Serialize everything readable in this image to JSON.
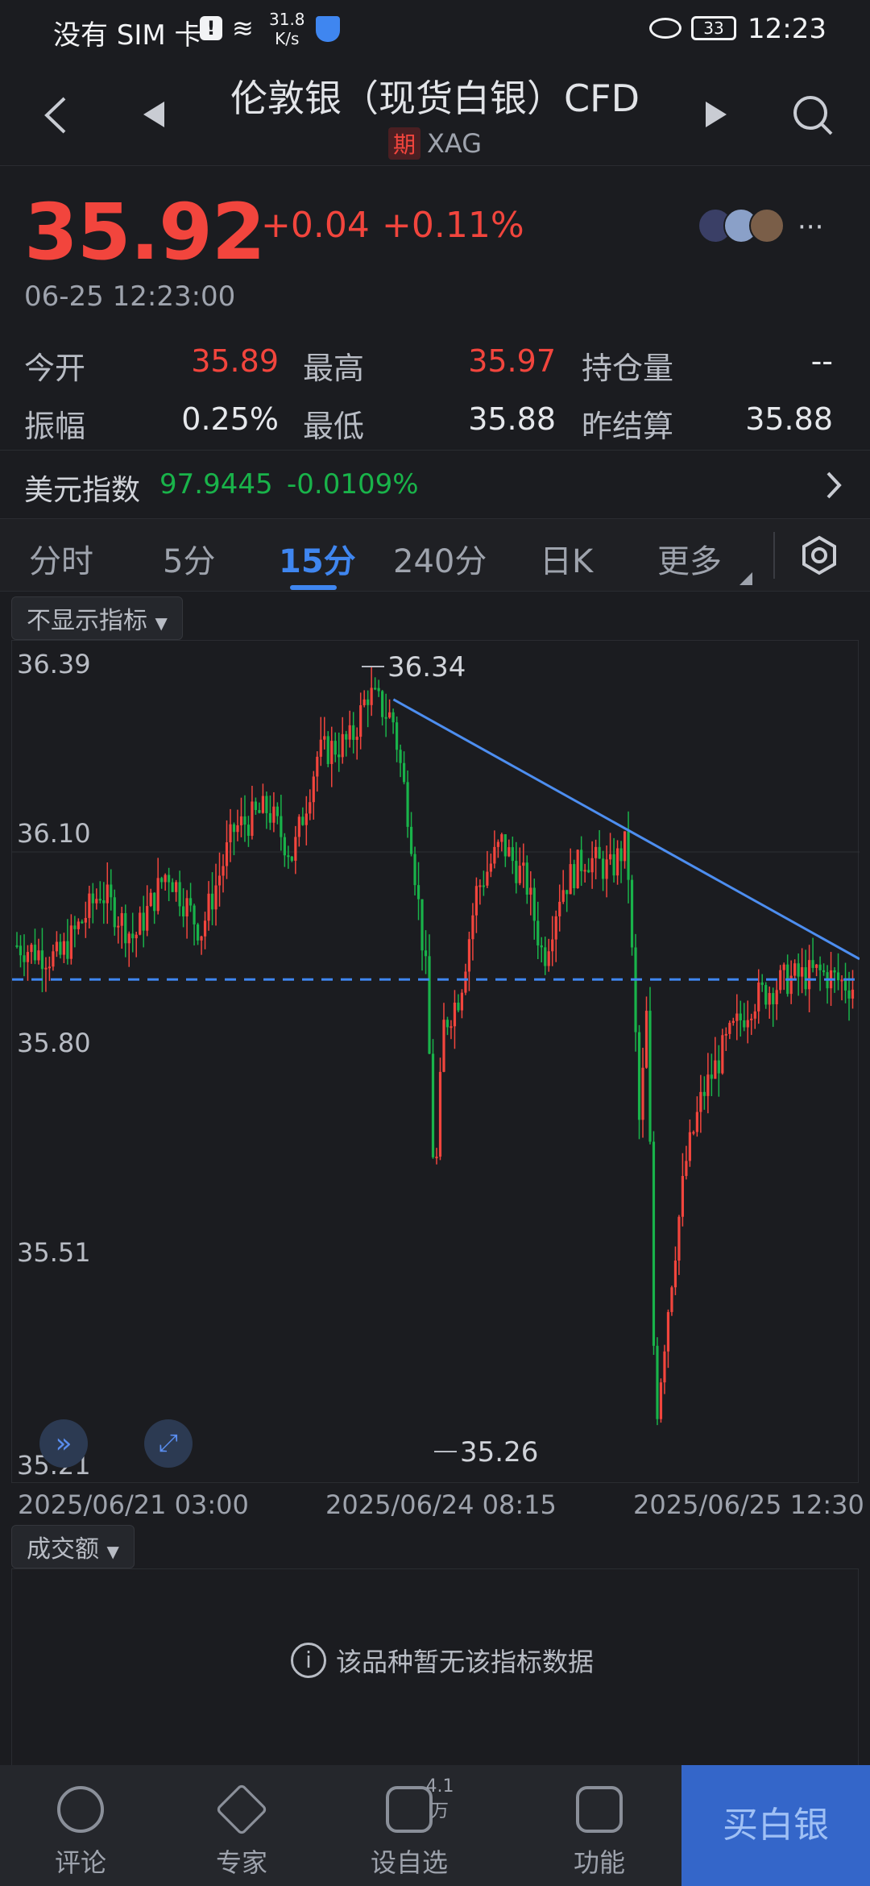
{
  "status": {
    "carrier": "没有 SIM 卡",
    "speed_value": "31.8",
    "speed_unit": "K/s",
    "battery": "33",
    "time": "12:23"
  },
  "header": {
    "title": "伦敦银（现货白银）CFD",
    "tag": "期",
    "symbol": "XAG"
  },
  "quote": {
    "price": "35.92",
    "change": "+0.04",
    "change_pct": "+0.11%",
    "timestamp": "06-25 12:23:00"
  },
  "stats": {
    "open_label": "今开",
    "open_value": "35.89",
    "high_label": "最高",
    "high_value": "35.97",
    "oi_label": "持仓量",
    "oi_value": "--",
    "amp_label": "振幅",
    "amp_value": "0.25%",
    "low_label": "最低",
    "low_value": "35.88",
    "prev_label": "昨结算",
    "prev_value": "35.88"
  },
  "usd_index": {
    "label": "美元指数",
    "value": "97.9445",
    "change": "-0.0109%"
  },
  "tabs": [
    {
      "label": "分时"
    },
    {
      "label": "5分"
    },
    {
      "label": "15分"
    },
    {
      "label": "240分"
    },
    {
      "label": "日K"
    },
    {
      "label": "更多"
    }
  ],
  "indicator_button": "不显示指标",
  "volume_button": "成交额",
  "no_data_text": "该品种暂无该指标数据",
  "chart_data": {
    "type": "candlestick",
    "y_ticks": [
      "36.39",
      "36.10",
      "35.80",
      "35.51",
      "35.21"
    ],
    "ylim": [
      35.21,
      36.39
    ],
    "x_ticks": [
      "2025/06/21 03:00",
      "2025/06/24 08:15",
      "2025/06/25 12:30"
    ],
    "max_label": "36.34",
    "min_label": "35.26",
    "reference_line": 35.92,
    "trendline": {
      "from": [
        0.45,
        36.33
      ],
      "to": [
        1.0,
        35.95
      ]
    },
    "colors": {
      "up": "#f2453d",
      "down": "#19b34a",
      "trend": "#4d8ef0",
      "ref": "#3f86f0"
    }
  },
  "bottom_nav": {
    "comment": "评论",
    "expert": "专家",
    "watch": "设自选",
    "watch_count": "4.1万",
    "function": "功能",
    "buy": "买白银"
  }
}
